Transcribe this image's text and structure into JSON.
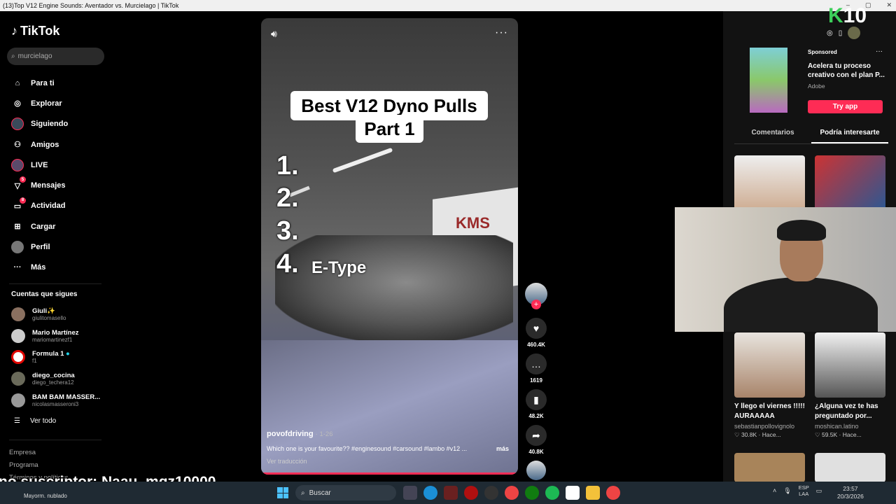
{
  "window": {
    "title": "(13)Top V12 Engine Sounds: Aventador vs. Murcielago | TikTok"
  },
  "sidebar": {
    "logo": "TikTok",
    "search_value": "murcielago",
    "nav": [
      {
        "label": "Para ti",
        "icon": "home-icon"
      },
      {
        "label": "Explorar",
        "icon": "compass-icon"
      },
      {
        "label": "Siguiendo",
        "icon": "following-icon"
      },
      {
        "label": "Amigos",
        "icon": "friends-icon"
      },
      {
        "label": "LIVE",
        "icon": "live-icon"
      },
      {
        "label": "Mensajes",
        "icon": "messages-icon",
        "badge": "5"
      },
      {
        "label": "Actividad",
        "icon": "activity-icon",
        "badge": "8"
      },
      {
        "label": "Cargar",
        "icon": "upload-icon"
      },
      {
        "label": "Perfil",
        "icon": "profile-icon"
      },
      {
        "label": "Más",
        "icon": "more-icon"
      }
    ],
    "following_title": "Cuentas que sigues",
    "following": [
      {
        "name": "Giuli✨",
        "handle": "giulitomasello"
      },
      {
        "name": "Mario Martínez",
        "handle": "mariomartinezf1"
      },
      {
        "name": "Formula 1",
        "handle": "f1"
      },
      {
        "name": "diego_cocina",
        "handle": "diego_techera12"
      },
      {
        "name": "BAM BAM MASSER...",
        "handle": "nicolasmasseroni3"
      }
    ],
    "see_all": "Ver todo",
    "footer": [
      "Empresa",
      "Programa",
      "Términos y políticas"
    ]
  },
  "video": {
    "title_line1": "Best V12 Dyno Pulls",
    "title_line2": "Part 1",
    "ranks": [
      "1.",
      "2.",
      "3.",
      "4."
    ],
    "rank4_label": "E-Type",
    "wall_sign": "KMS",
    "author": "povofdriving",
    "duration": "· 1-26",
    "description": "Which one is your favourite?? #enginesound #carsound #lambo #v12 ...",
    "more_label": "más",
    "translate": "Ver traducción"
  },
  "actions": {
    "likes": "460.4K",
    "comments": "1619",
    "saves": "48.2K",
    "shares": "40.8K"
  },
  "right": {
    "badge_letter": "K",
    "badge_number": "10",
    "ad": {
      "sponsored": "Sponsored",
      "title": "Acelera tu proceso creativo con el plan P...",
      "brand": "Adobe",
      "cta": "Try app"
    },
    "tabs": [
      "Comentarios",
      "Podría interesarte"
    ],
    "cards": [
      {
        "title": "",
        "user": "",
        "meta": ""
      },
      {
        "title": "",
        "user": "",
        "meta": ""
      },
      {
        "title": "Y llego el viernes !!!!! AURAAAAA",
        "user": "sebastianpollovignolo",
        "meta": "♡ 30.8K · Hace..."
      },
      {
        "title": "¿Alguna vez te has preguntado por...",
        "user": "moshican.latino",
        "meta": "♡ 59.5K · Hace..."
      }
    ]
  },
  "overlay": {
    "subscriber_text": "no suscriptor: Naau_mqz10000"
  },
  "taskbar": {
    "weather": "Mayorm. nublado",
    "search": "Buscar",
    "lang_top": "ESP",
    "lang_bottom": "LAA",
    "time": "23:57",
    "date": "20/3/2026"
  },
  "colors": {
    "accent": "#fe2c55",
    "background": "#000000",
    "panel": "#121212"
  }
}
